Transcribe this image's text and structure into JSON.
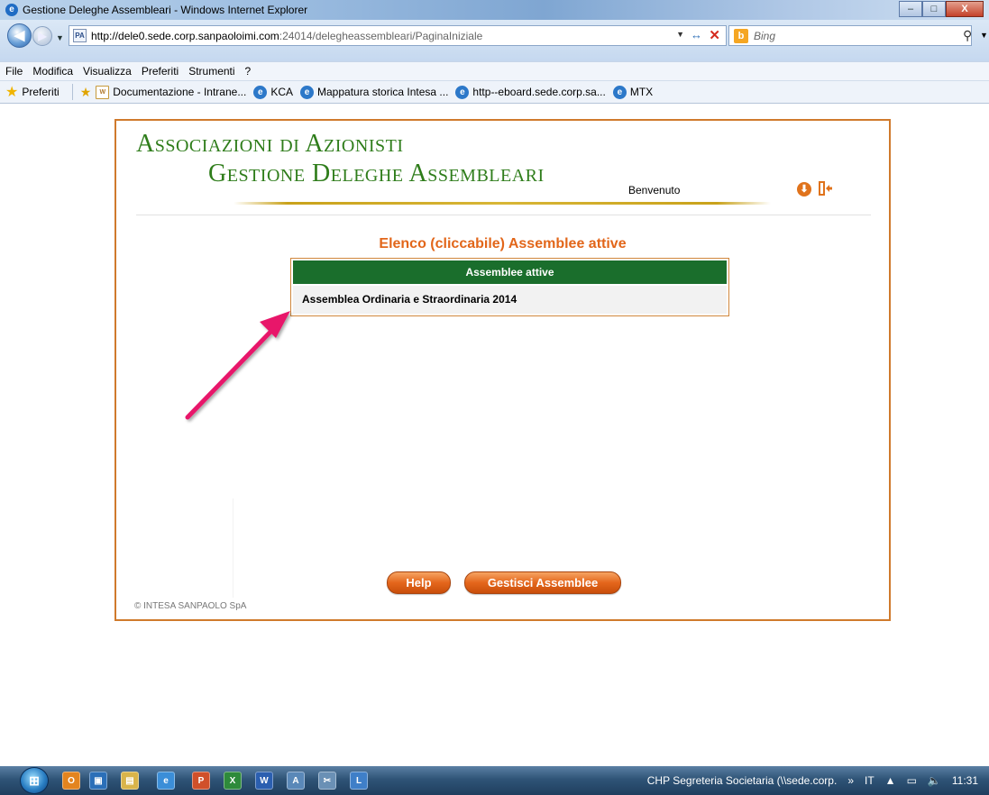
{
  "window": {
    "title": "Gestione Deleghe Assembleari - Windows Internet Explorer"
  },
  "addressbar": {
    "url_host": "http://dele0.sede.corp.sanpaoloimi.com",
    "url_path": ":24014/delegheassembleari/PaginaIniziale",
    "search_placeholder": "Bing"
  },
  "menubar": {
    "items": [
      "File",
      "Modifica",
      "Visualizza",
      "Preferiti",
      "Strumenti",
      "?"
    ]
  },
  "favorites": {
    "label": "Preferiti",
    "items": [
      {
        "label": "Documentazione - Intrane...",
        "icon": "page-icon"
      },
      {
        "label": "KCA",
        "icon": "ie-icon"
      },
      {
        "label": "Mappatura storica Intesa ...",
        "icon": "ie-icon"
      },
      {
        "label": "http--eboard.sede.corp.sa...",
        "icon": "ie-icon"
      },
      {
        "label": "MTX",
        "icon": "ie-icon"
      }
    ]
  },
  "page": {
    "brand_line1": "Associazioni di Azionisti",
    "brand_line2": "Gestione Deleghe Assembleari",
    "welcome": "Benvenuto",
    "list_title": "Elenco (cliccabile) Assemblee attive",
    "list_header": "Assemblee attive",
    "assemblies": [
      "Assemblea Ordinaria e Straordinaria 2014"
    ],
    "help_button": "Help",
    "manage_button": "Gestisci Assemblee",
    "copyright": "© INTESA SANPAOLO SpA"
  },
  "taskbar": {
    "tray_text": "CHP Segreteria Societaria (\\\\sede.corp.",
    "language": "IT",
    "clock": "11:31"
  },
  "colors": {
    "brand_green": "#2f7d1b",
    "accent_orange": "#e2661a",
    "header_green": "#1a6e2c",
    "arrow_pink": "#e8196b"
  }
}
